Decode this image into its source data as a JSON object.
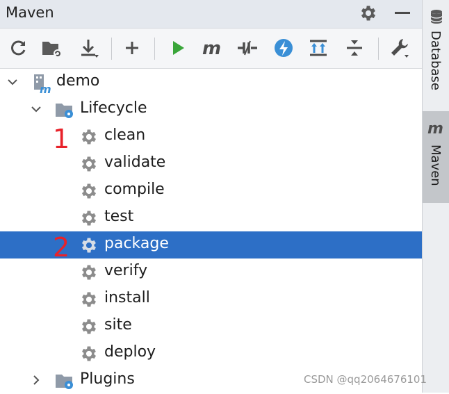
{
  "panel": {
    "title": "Maven",
    "title_icons": [
      "gear-icon",
      "minimize-icon"
    ]
  },
  "toolbar": {
    "buttons": [
      {
        "name": "reload-icon"
      },
      {
        "name": "generate-sources-icon"
      },
      {
        "name": "download-icon"
      },
      {
        "name": "add-icon"
      },
      {
        "name": "run-icon"
      },
      {
        "name": "execute-goal-icon"
      },
      {
        "name": "toggle-offline-icon"
      },
      {
        "name": "skip-tests-icon"
      },
      {
        "name": "show-dependencies-icon"
      },
      {
        "name": "collapse-all-icon"
      },
      {
        "name": "settings-wrench-icon"
      }
    ]
  },
  "tree": {
    "project": "demo",
    "lifecycle_label": "Lifecycle",
    "goals": [
      "clean",
      "validate",
      "compile",
      "test",
      "package",
      "verify",
      "install",
      "site",
      "deploy"
    ],
    "selected_goal": "package",
    "plugins_label": "Plugins"
  },
  "annotations": {
    "marker_1": "1",
    "marker_2": "2"
  },
  "sidebar": {
    "tabs": [
      {
        "label": "Database",
        "icon": "database-icon",
        "active": false
      },
      {
        "label": "Maven",
        "icon": "maven-m-icon",
        "active": true
      }
    ]
  },
  "watermark": "CSDN @qq2064676101",
  "colors": {
    "selection": "#2d6fc6",
    "run_green": "#3aa63a",
    "gear_gray": "#8c8c8c",
    "folder_gray": "#8f9aa8",
    "folder_badge_blue": "#3a8fd6",
    "marker_red": "#e8222a"
  }
}
